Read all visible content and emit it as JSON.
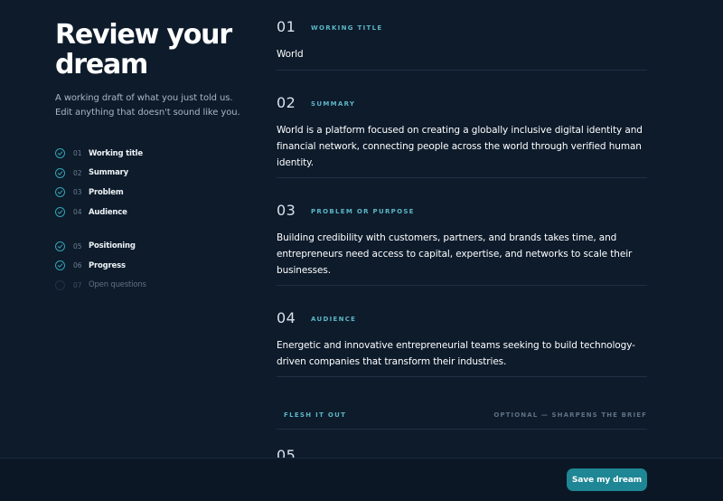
{
  "header": {
    "title_line1": "Review your",
    "title_line2": "dream",
    "subtitle": "A working draft of what you just told us. Edit anything that doesn't sound like you."
  },
  "steps": [
    {
      "num": "01",
      "label": "Working title",
      "done": true
    },
    {
      "num": "02",
      "label": "Summary",
      "done": true
    },
    {
      "num": "03",
      "label": "Problem",
      "done": true
    },
    {
      "num": "04",
      "label": "Audience",
      "done": true
    },
    {
      "num": "05",
      "label": "Positioning",
      "done": true
    },
    {
      "num": "06",
      "label": "Progress",
      "done": true
    },
    {
      "num": "07",
      "label": "Open questions",
      "done": false
    }
  ],
  "sections": [
    {
      "num": "01",
      "label": "WORKING TITLE",
      "body": "World"
    },
    {
      "num": "02",
      "label": "SUMMARY",
      "body": "World is a platform focused on creating a globally inclusive digital identity and financial network, connecting people across the world through verified human identity."
    },
    {
      "num": "03",
      "label": "PROBLEM OR PURPOSE",
      "body": "Building credibility with customers, partners, and brands takes time, and entrepreneurs need access to capital, expertise, and networks to scale their businesses."
    },
    {
      "num": "04",
      "label": "AUDIENCE",
      "body": "Energetic and innovative entrepreneurial teams seeking to build technology-driven companies that transform their industries."
    }
  ],
  "flesh": {
    "left": "FLESH IT OUT",
    "right": "OPTIONAL — SHARPENS THE BRIEF"
  },
  "section5_num": "05",
  "footer": {
    "save_label": "Save my dream"
  },
  "colors": {
    "background": "#0d1b2b",
    "accent": "#5cb5c5",
    "button": "#1e8694",
    "check": "#34a3b2"
  },
  "icons": {
    "step_done": "check-circle-icon",
    "step_pending": "empty-circle-icon"
  }
}
